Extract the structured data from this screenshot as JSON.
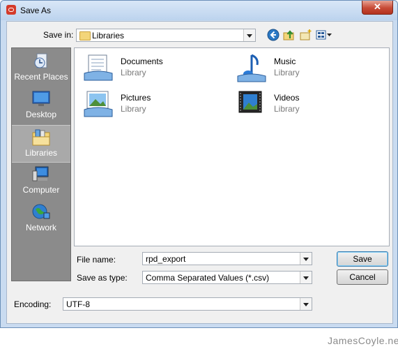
{
  "window": {
    "title": "Save As",
    "close_glyph": "✕"
  },
  "toolbar": {
    "save_in_label": "Save in:",
    "save_in_value": "Libraries",
    "icons": [
      "back-icon",
      "up-folder-icon",
      "new-folder-icon",
      "views-menu-icon"
    ]
  },
  "places": [
    {
      "label": "Recent Places",
      "icon": "recent-places-icon",
      "selected": false
    },
    {
      "label": "Desktop",
      "icon": "desktop-icon",
      "selected": false
    },
    {
      "label": "Libraries",
      "icon": "libraries-icon",
      "selected": true
    },
    {
      "label": "Computer",
      "icon": "computer-icon",
      "selected": false
    },
    {
      "label": "Network",
      "icon": "network-icon",
      "selected": false
    }
  ],
  "libraries": [
    {
      "name": "Documents",
      "type": "Library",
      "icon": "documents-library-icon"
    },
    {
      "name": "Music",
      "type": "Library",
      "icon": "music-library-icon"
    },
    {
      "name": "Pictures",
      "type": "Library",
      "icon": "pictures-library-icon"
    },
    {
      "name": "Videos",
      "type": "Library",
      "icon": "videos-library-icon"
    }
  ],
  "form": {
    "file_name_label": "File name:",
    "file_name_value": "rpd_export",
    "save_as_type_label": "Save as type:",
    "save_as_type_value": "Comma Separated Values (*.csv)",
    "encoding_label": "Encoding:",
    "encoding_value": "UTF-8"
  },
  "buttons": {
    "save": "Save",
    "cancel": "Cancel"
  },
  "watermark": "JamesCoyle.net",
  "colors": {
    "title_bar": "#c9dbf0",
    "sidebar": "#8b8b8b",
    "close_button": "#c74a36"
  }
}
